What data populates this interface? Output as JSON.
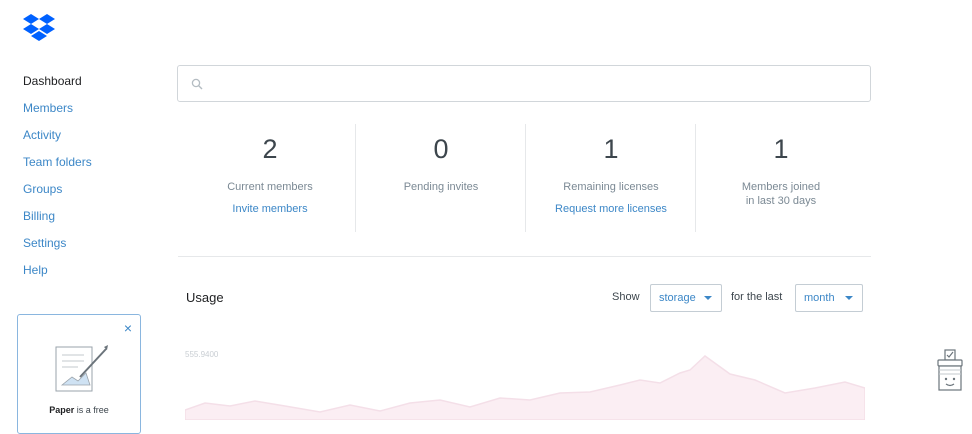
{
  "sidebar": {
    "items": [
      {
        "label": "Dashboard",
        "active": true
      },
      {
        "label": "Members"
      },
      {
        "label": "Activity"
      },
      {
        "label": "Team folders"
      },
      {
        "label": "Groups"
      },
      {
        "label": "Billing"
      },
      {
        "label": "Settings"
      },
      {
        "label": "Help"
      }
    ]
  },
  "promo": {
    "close": "×",
    "text_bold": "Paper",
    "text_rest": " is a free"
  },
  "search": {
    "placeholder": "",
    "value": ""
  },
  "stats": [
    {
      "number": "2",
      "label": "Current members",
      "link": "Invite members"
    },
    {
      "number": "0",
      "label": "Pending invites",
      "link": ""
    },
    {
      "number": "1",
      "label": "Remaining licenses",
      "link": "Request more licenses"
    },
    {
      "number": "1",
      "label_line1": "Members joined",
      "label_line2": "in last 30 days",
      "link": ""
    }
  ],
  "usage": {
    "title": "Usage",
    "show_label": "Show",
    "show_value": "storage",
    "for_the_last_label": "for the last",
    "period_value": "month",
    "chart_axis_label": "555.9400"
  },
  "colors": {
    "link": "#3c87c7",
    "chart_fill": "#fbeef3",
    "chart_line": "#f4dfe8"
  },
  "icons": {
    "logo": "dropbox-logo",
    "search": "search-icon",
    "help_widget": "feedback-box-icon"
  }
}
